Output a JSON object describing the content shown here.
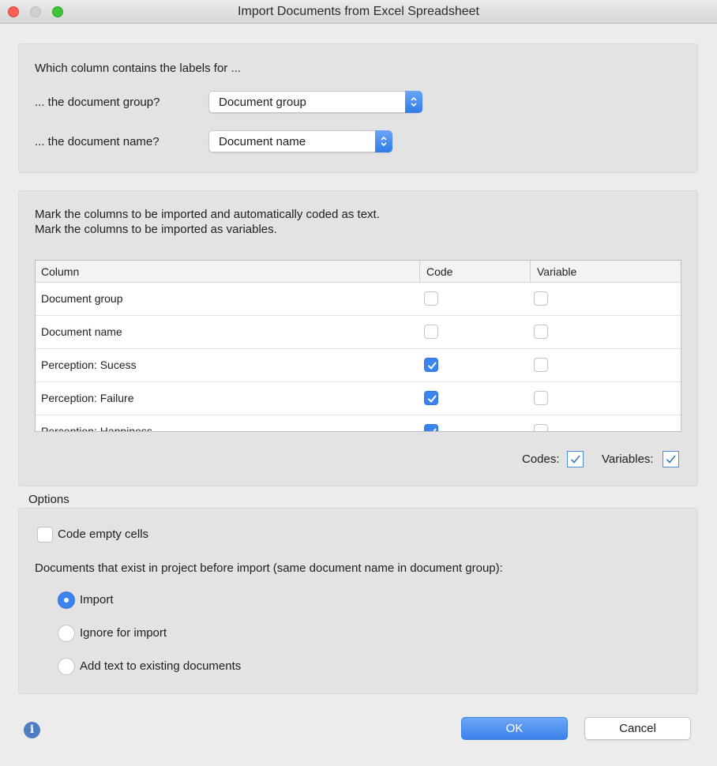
{
  "window": {
    "title": "Import Documents from Excel Spreadsheet"
  },
  "labels_section": {
    "heading": "Which column contains the labels for ...",
    "group_prompt": "... the document group?",
    "group_select_value": "Document group",
    "name_prompt": "... the document name?",
    "name_select_value": "Document name"
  },
  "columns_section": {
    "instruction_line1": "Mark the columns to be imported and automatically coded as text.",
    "instruction_line2": "Mark the columns to be imported as variables.",
    "table": {
      "headers": [
        "Column",
        "Code",
        "Variable"
      ],
      "rows": [
        {
          "column": "Document group",
          "code": false,
          "variable": false
        },
        {
          "column": "Document name",
          "code": false,
          "variable": false
        },
        {
          "column": "Perception: Sucess",
          "code": true,
          "variable": false
        },
        {
          "column": "Perception: Failure",
          "code": true,
          "variable": false
        },
        {
          "column": "Perception: Happiness",
          "code": true,
          "variable": false
        }
      ]
    },
    "codes_label": "Codes:",
    "codes_checked": true,
    "variables_label": "Variables:",
    "variables_checked": true
  },
  "options": {
    "section_title": "Options",
    "code_empty_cells_label": "Code empty cells",
    "code_empty_cells_checked": false,
    "existing_docs_prompt": "Documents that exist in project before import (same document name in document group):",
    "radio_options": [
      "Import",
      "Ignore for import",
      "Add text to existing documents"
    ],
    "selected_option": "Import"
  },
  "footer": {
    "ok_label": "OK",
    "cancel_label": "Cancel",
    "info_icon": "info-icon"
  },
  "colors": {
    "accent": "#3b84ef",
    "panel_bg": "#e3e3e3",
    "window_bg": "#ececec"
  }
}
